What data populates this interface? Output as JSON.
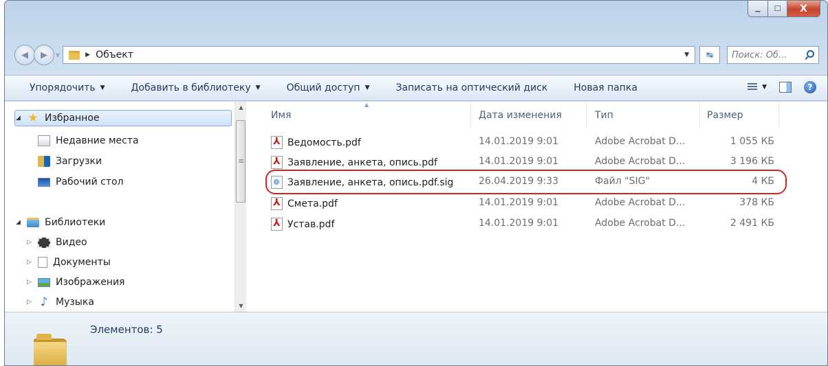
{
  "window": {
    "controls": {
      "minimize": "▁",
      "maximize": "☐",
      "close": "X"
    }
  },
  "address_bar": {
    "path": [
      "Объект"
    ],
    "search_placeholder": "Поиск: Об..."
  },
  "toolbar": {
    "organize": "Упорядочить",
    "add_to_library": "Добавить в библиотеку",
    "share": "Общий доступ",
    "burn": "Записать на оптический диск",
    "new_folder": "Новая папка"
  },
  "nav": {
    "favorites": {
      "label": "Избранное",
      "items": [
        "Недавние места",
        "Загрузки",
        "Рабочий стол"
      ]
    },
    "libraries": {
      "label": "Библиотеки",
      "items": [
        "Видео",
        "Документы",
        "Изображения",
        "Музыка"
      ]
    }
  },
  "columns": {
    "name": "Имя",
    "date": "Дата изменения",
    "type": "Тип",
    "size": "Размер"
  },
  "files": [
    {
      "name": "Ведомость.pdf",
      "date": "14.01.2019 9:01",
      "type": "Adobe Acrobat D...",
      "size": "1 055 КБ",
      "icon": "pdf-icon"
    },
    {
      "name": "Заявление, анкета, опись.pdf",
      "date": "14.01.2019 9:01",
      "type": "Adobe Acrobat D...",
      "size": "3 196 КБ",
      "icon": "pdf-icon"
    },
    {
      "name": "Заявление, анкета, опись.pdf.sig",
      "date": "26.04.2019 9:33",
      "type": "Файл \"SIG\"",
      "size": "4 КБ",
      "icon": "sig-file-icon",
      "highlighted": true
    },
    {
      "name": "Смета.pdf",
      "date": "14.01.2019 9:01",
      "type": "Adobe Acrobat D...",
      "size": "378 КБ",
      "icon": "pdf-icon"
    },
    {
      "name": "Устав.pdf",
      "date": "14.01.2019 9:01",
      "type": "Adobe Acrobat D...",
      "size": "2 491 КБ",
      "icon": "pdf-icon"
    }
  ],
  "details": {
    "item_count": "Элементов: 5"
  },
  "colors": {
    "highlight_border": "#d32422",
    "pdf_red": "#d41b10",
    "toolbar_text": "#1e395b"
  }
}
